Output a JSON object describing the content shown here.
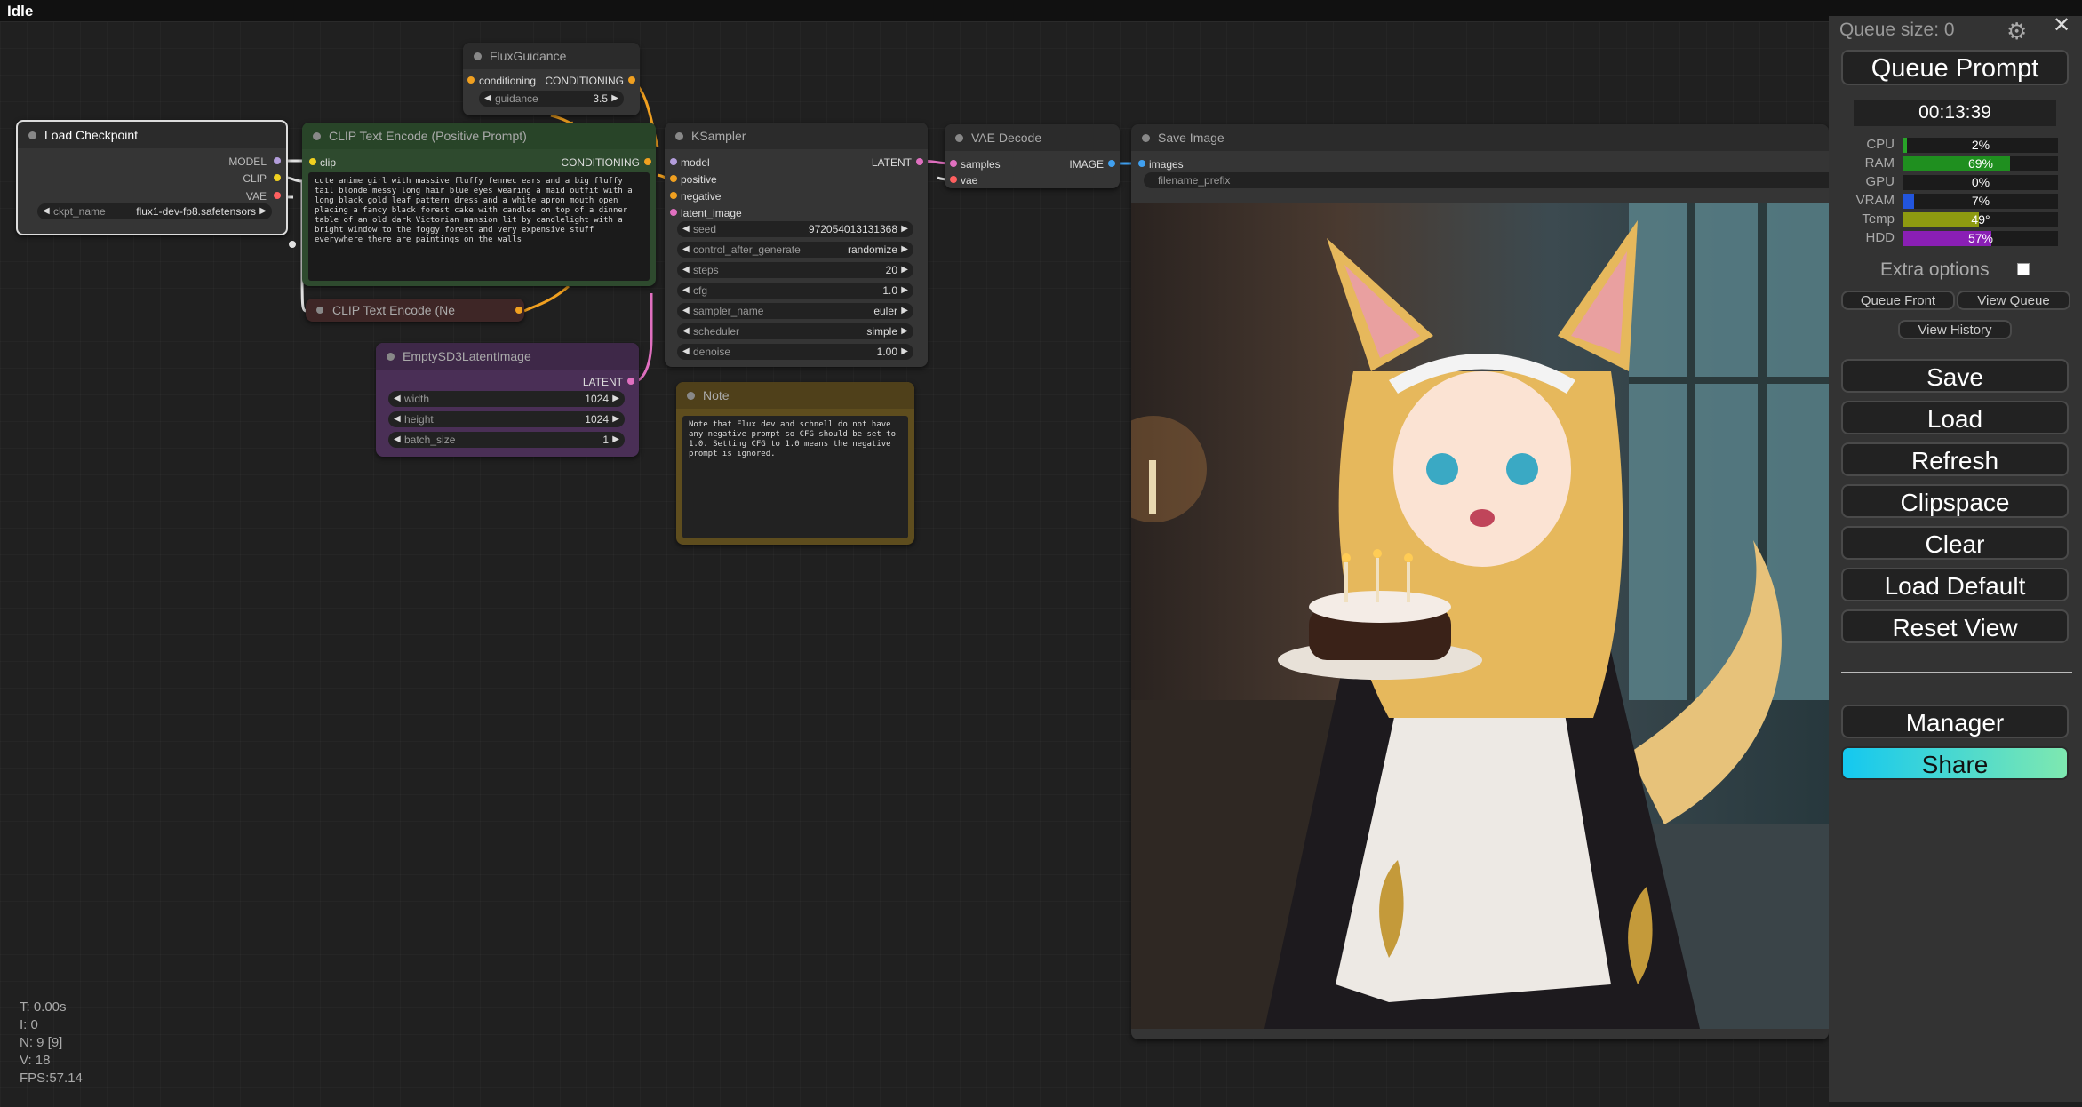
{
  "topbar": {
    "status": "Idle"
  },
  "stats": {
    "t": "T: 0.00s",
    "i": "I: 0",
    "n": "N: 9 [9]",
    "v": "V: 18",
    "fps": "FPS:57.14"
  },
  "nodes": {
    "flux_guidance": {
      "title": "FluxGuidance",
      "input": "conditioning",
      "output": "CONDITIONING",
      "widget_label": "guidance",
      "widget_value": "3.5"
    },
    "load_checkpoint": {
      "title": "Load Checkpoint",
      "outputs": [
        "MODEL",
        "CLIP",
        "VAE"
      ],
      "widget_label": "ckpt_name",
      "widget_value": "flux1-dev-fp8.safetensors"
    },
    "clip_positive": {
      "title": "CLIP Text Encode (Positive Prompt)",
      "input": "clip",
      "output": "CONDITIONING",
      "text": "cute anime girl with massive fluffy fennec ears and a big fluffy tail blonde messy long hair blue eyes wearing a maid outfit with a long black gold leaf pattern dress and a white apron mouth open placing a fancy black forest cake with candles on top of a dinner table of an old dark Victorian mansion lit by candlelight with a bright window to the foggy forest and very expensive stuff everywhere there are paintings on the walls"
    },
    "clip_negative": {
      "title": "CLIP Text Encode (Ne"
    },
    "empty_latent": {
      "title": "EmptySD3LatentImage",
      "output": "LATENT",
      "widgets": [
        {
          "label": "width",
          "value": "1024"
        },
        {
          "label": "height",
          "value": "1024"
        },
        {
          "label": "batch_size",
          "value": "1"
        }
      ]
    },
    "ksampler": {
      "title": "KSampler",
      "inputs": [
        "model",
        "positive",
        "negative",
        "latent_image"
      ],
      "output": "LATENT",
      "widgets": [
        {
          "label": "seed",
          "value": "972054013131368"
        },
        {
          "label": "control_after_generate",
          "value": "randomize"
        },
        {
          "label": "steps",
          "value": "20"
        },
        {
          "label": "cfg",
          "value": "1.0"
        },
        {
          "label": "sampler_name",
          "value": "euler"
        },
        {
          "label": "scheduler",
          "value": "simple"
        },
        {
          "label": "denoise",
          "value": "1.00"
        }
      ]
    },
    "note": {
      "title": "Note",
      "text": "Note that Flux dev and schnell do not have any negative prompt so CFG should be set to 1.0. Setting CFG to 1.0 means the negative prompt is ignored."
    },
    "vae_decode": {
      "title": "VAE Decode",
      "inputs": [
        "samples",
        "vae"
      ],
      "output": "IMAGE"
    },
    "save_image": {
      "title": "Save Image",
      "input": "images",
      "widget_label": "filename_prefix"
    }
  },
  "panel": {
    "queue_size": "Queue size: 0",
    "queue_prompt": "Queue Prompt",
    "timer": "00:13:39",
    "monitors": [
      {
        "label": "CPU",
        "value": "2%",
        "fill": 0.02,
        "color": "#28a428"
      },
      {
        "label": "RAM",
        "value": "69%",
        "fill": 0.69,
        "color": "#1f8f1f"
      },
      {
        "label": "GPU",
        "value": "0%",
        "fill": 0.0,
        "color": "#28a428"
      },
      {
        "label": "VRAM",
        "value": "7%",
        "fill": 0.07,
        "color": "#2255dd"
      },
      {
        "label": "Temp",
        "value": "49°",
        "fill": 0.49,
        "color": "#8e9a10"
      },
      {
        "label": "HDD",
        "value": "57%",
        "fill": 0.57,
        "color": "#8a1fb5"
      }
    ],
    "extra_options": "Extra options",
    "queue_front": "Queue Front",
    "view_queue": "View Queue",
    "view_history": "View History",
    "buttons": [
      "Save",
      "Load",
      "Refresh",
      "Clipspace",
      "Clear",
      "Load Default",
      "Reset View"
    ],
    "manager": "Manager",
    "share": "Share"
  }
}
